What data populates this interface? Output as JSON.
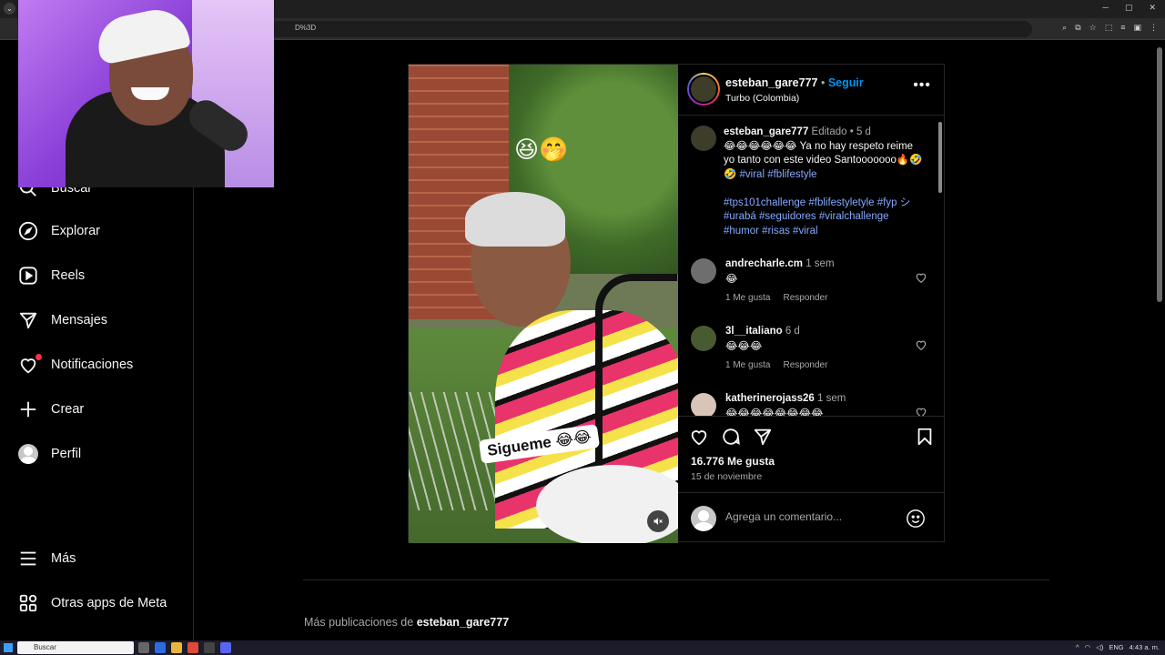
{
  "browser": {
    "url_fragment": "D%3D"
  },
  "sidebar": {
    "items": [
      {
        "label": "Buscar",
        "icon": "search-icon"
      },
      {
        "label": "Explorar",
        "icon": "compass-icon"
      },
      {
        "label": "Reels",
        "icon": "reels-icon"
      },
      {
        "label": "Mensajes",
        "icon": "send-icon"
      },
      {
        "label": "Notificaciones",
        "icon": "heart-icon"
      },
      {
        "label": "Crear",
        "icon": "plus-icon"
      },
      {
        "label": "Perfil",
        "icon": "avatar"
      },
      {
        "label": "Más",
        "icon": "menu-icon"
      },
      {
        "label": "Otras apps de Meta",
        "icon": "apps-icon"
      }
    ]
  },
  "post": {
    "header": {
      "username": "esteban_gare777",
      "separator": "•",
      "follow": "Seguir",
      "location": "Turbo (Colombia)"
    },
    "media": {
      "emoji_top": "😆🤭",
      "sticker": "Sigueme 😂😂"
    },
    "caption": {
      "username": "esteban_gare777",
      "meta": "Editado • 5 d",
      "line1": "😂😂😂😂😂😂 Ya no hay respeto reime yo tanto con este video Santooooooo🔥🤣🤣",
      "tags1": "#viral #fblifestyle",
      "tags2": "#tps101challenge #fblifestyletyle #fyp シ #urabá #seguidores #viralchallenge #humor #risas #viral"
    },
    "comments": [
      {
        "user": "andrecharle.cm",
        "time": "1 sem",
        "text": "😂",
        "likes": "1 Me gusta",
        "reply": "Responder",
        "avatar_color": "#6e6e6e"
      },
      {
        "user": "3l__italiano",
        "time": "6 d",
        "text": "😂😂😂",
        "likes": "1 Me gusta",
        "reply": "Responder",
        "avatar_color": "#4a5a30"
      },
      {
        "user": "katherinerojass26",
        "time": "1 sem",
        "text": "😂😂😂😂😂😂😂😂",
        "likes": "",
        "reply": "",
        "avatar_color": "#d9c4b8"
      }
    ],
    "likes": "16.776 Me gusta",
    "date": "15 de noviembre",
    "add_comment_placeholder": "Agrega un comentario..."
  },
  "more_posts": {
    "prefix": "Más publicaciones de",
    "username": "esteban_gare777"
  },
  "taskbar": {
    "search": "Buscar",
    "lang": "ENG",
    "time": "4:43 a. m."
  },
  "colors": {
    "accent": "#0095f6",
    "hashtag": "#85a9ff",
    "background": "#000000",
    "notification": "#ff3040"
  }
}
